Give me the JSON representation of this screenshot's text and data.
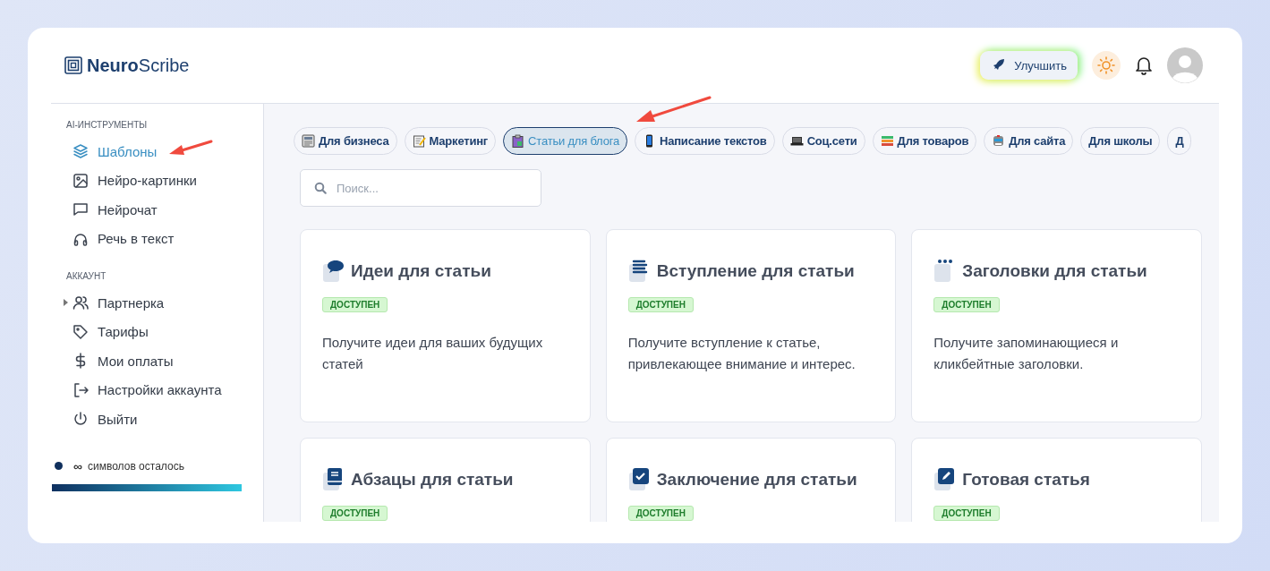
{
  "header": {
    "logo": "**Neuro**Scribe",
    "upgrade_button": "Улучшить"
  },
  "sidebar": {
    "sections": [
      {
        "title": "AI-ИНСТРУМЕНТЫ",
        "items": [
          {
            "label": "Шаблоны",
            "selected": true,
            "kind": "link"
          },
          {
            "label": "Нейро-картинки",
            "selected": false,
            "kind": "link"
          },
          {
            "label": "Нейрочат",
            "selected": false,
            "kind": "link"
          },
          {
            "label": "Речь в текст",
            "selected": false,
            "kind": "link"
          }
        ]
      },
      {
        "title": "АККАУНТ",
        "items": [
          {
            "label": "Партнерка",
            "selected": false,
            "kind": "group"
          },
          {
            "label": "Тарифы",
            "selected": false,
            "kind": "link"
          },
          {
            "label": "Мои оплаты",
            "selected": false,
            "kind": "link"
          },
          {
            "label": "Настройки аккаунта",
            "selected": false,
            "kind": "link"
          },
          {
            "label": "Выйти",
            "selected": false,
            "kind": "link"
          }
        ]
      }
    ],
    "counter": {
      "amount": "∞",
      "label": "символов осталось",
      "level": 1
    }
  },
  "categories": [
    {
      "label": "Для бизнеса",
      "selected": false
    },
    {
      "label": "Маркетинг",
      "selected": false
    },
    {
      "label": "Статьи для блога",
      "selected": true
    },
    {
      "label": "Написание текстов",
      "selected": false
    },
    {
      "label": "Соц.сети",
      "selected": false
    },
    {
      "label": "Для товаров",
      "selected": false
    },
    {
      "label": "Для сайта",
      "selected": false
    },
    {
      "label": "Для школы",
      "selected": false
    },
    {
      "label": "Д",
      "selected": false
    }
  ],
  "search": {
    "placeholder": "Поиск..."
  },
  "templates": [
    {
      "title": "Идеи для статьи",
      "badge": "ДОСТУПЕН",
      "description": "Получите идеи для ваших будущих статей"
    },
    {
      "title": "Вступление для статьи",
      "badge": "ДОСТУПЕН",
      "description": "Получите вступление к статье, привлекающее внимание и интерес."
    },
    {
      "title": "Заголовки для статьи",
      "badge": "ДОСТУПЕН",
      "description": "Получите запоминающиеся и кликбейтные заголовки."
    },
    {
      "title": "Абзацы для статьи",
      "badge": "ДОСТУПЕН"
    },
    {
      "title": "Заключение для статьи",
      "badge": "ДОСТУПЕН"
    },
    {
      "title": "Готовая статья",
      "badge": "ДОСТУПЕН"
    }
  ]
}
